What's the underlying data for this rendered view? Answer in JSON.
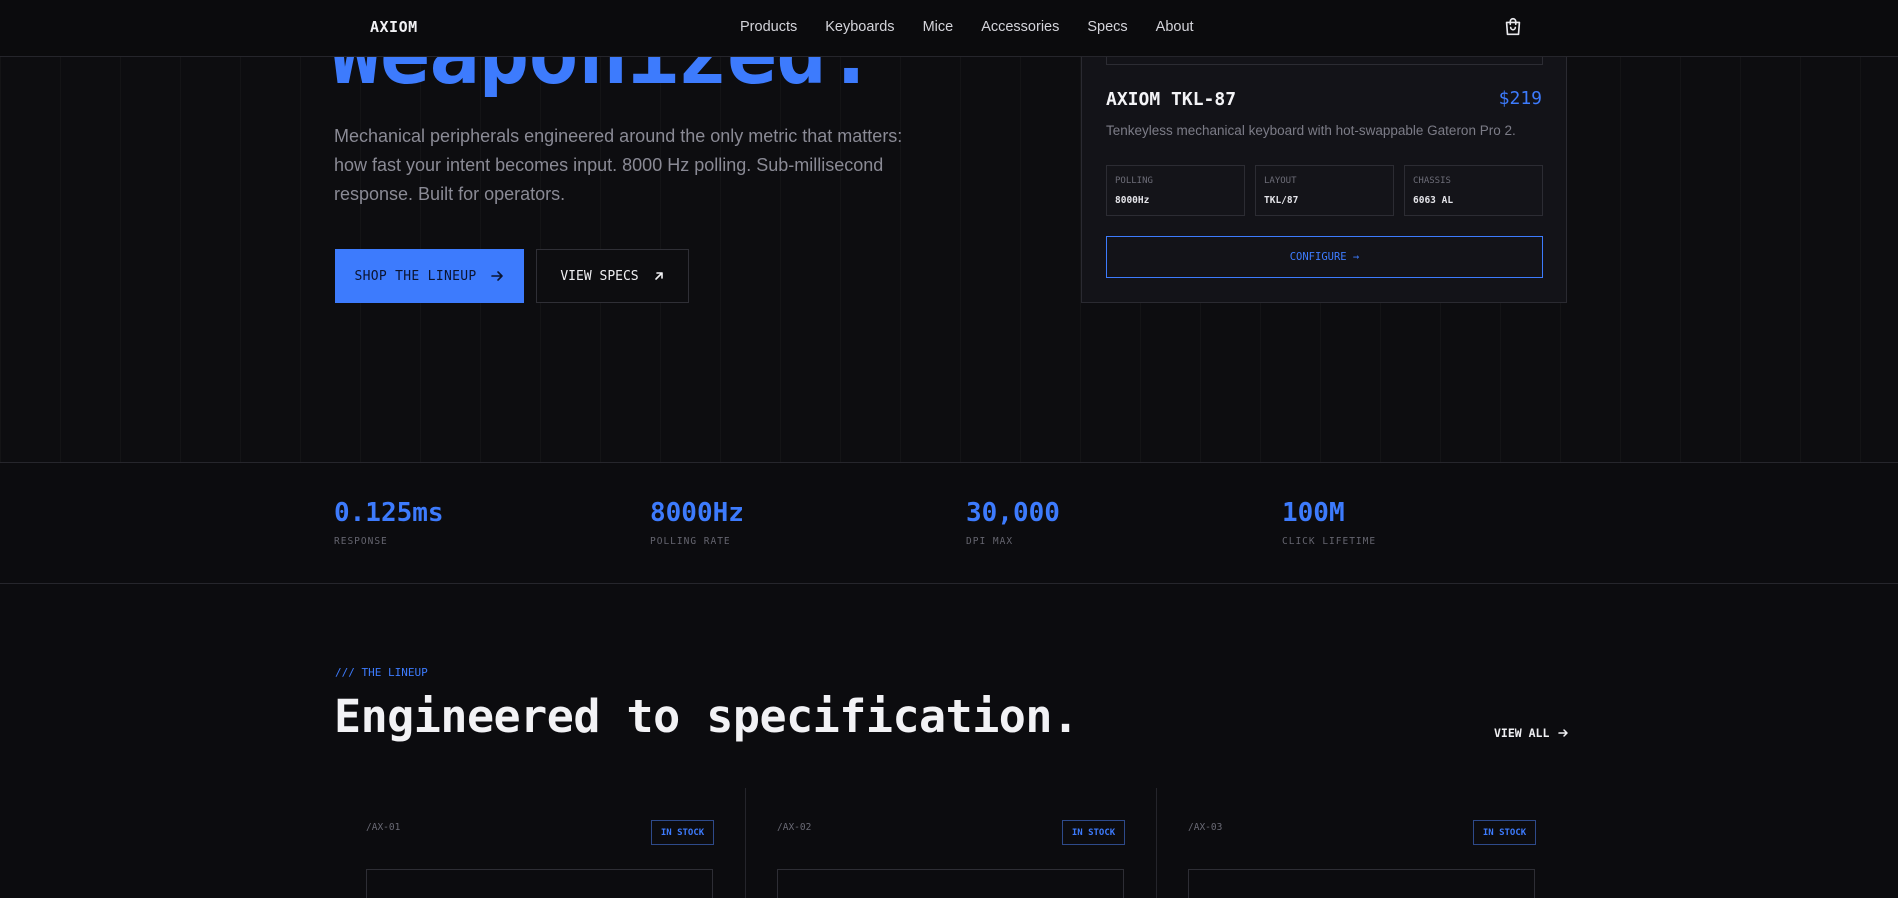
{
  "nav": {
    "logo": "AXIOM",
    "links": [
      "Products",
      "Keyboards",
      "Mice",
      "Accessories",
      "Specs",
      "About"
    ],
    "cart_icon": "shopping-bag-icon"
  },
  "hero": {
    "headline": "Weaponized.",
    "description": "Mechanical peripherals engineered around the only metric that matters: how fast your intent becomes input. 8000 Hz polling. Sub-millisecond response. Built for operators.",
    "primary_cta": "SHOP THE LINEUP",
    "secondary_cta": "VIEW SPECS"
  },
  "featured_product": {
    "name": "AXIOM TKL-87",
    "price": "$219",
    "description": "Tenkeyless mechanical keyboard with hot-swappable Gateron Pro 2.",
    "specs": [
      {
        "label": "POLLING",
        "value": "8000Hz"
      },
      {
        "label": "LAYOUT",
        "value": "TKL/87"
      },
      {
        "label": "CHASSIS",
        "value": "6063 AL"
      }
    ],
    "configure_label": "CONFIGURE →"
  },
  "stats": [
    {
      "value": "0.125ms",
      "label": "RESPONSE"
    },
    {
      "value": "8000Hz",
      "label": "POLLING RATE"
    },
    {
      "value": "30,000",
      "label": "DPI MAX"
    },
    {
      "value": "100M",
      "label": "CLICK LIFETIME"
    }
  ],
  "lineup": {
    "tag": "/// THE LINEUP",
    "title": "Engineered to specification.",
    "view_all": "VIEW ALL",
    "products": [
      {
        "id": "/AX-01",
        "badge": "IN STOCK"
      },
      {
        "id": "/AX-02",
        "badge": "IN STOCK"
      },
      {
        "id": "/AX-03",
        "badge": "IN STOCK"
      }
    ]
  },
  "colors": {
    "accent": "#3d7bfd",
    "background": "#0c0c0f",
    "card": "#131318"
  }
}
